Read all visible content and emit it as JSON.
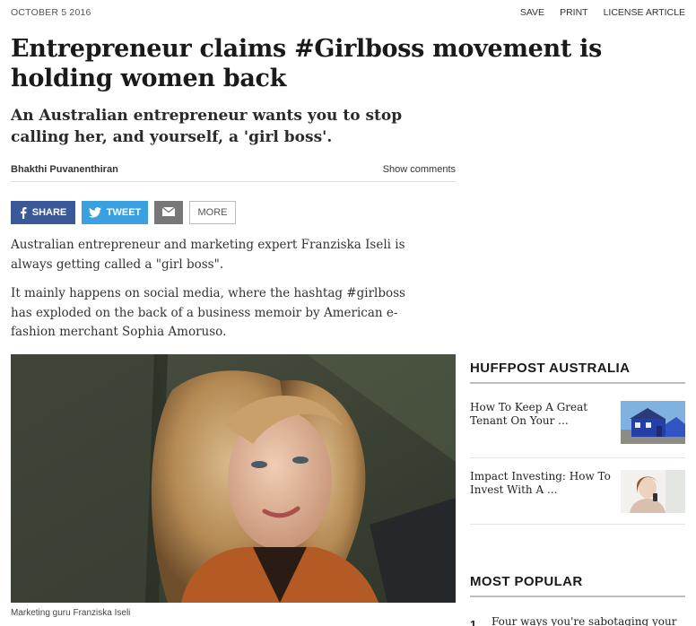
{
  "meta": {
    "date": "OCTOBER 5 2016",
    "actions": {
      "save": "SAVE",
      "print": "PRINT",
      "license": "LICENSE ARTICLE"
    }
  },
  "article": {
    "headline": "Entrepreneur claims #Girlboss movement is holding women back",
    "subhead": "An Australian entrepreneur wants you to stop calling her, and yourself, a 'girl boss'.",
    "author": "Bhakthi Puvanenthiran",
    "show_comments": "Show comments",
    "paragraphs": [
      "Australian entrepreneur and marketing expert Franziska Iseli is always getting called a \"girl boss\".",
      "It mainly happens on social media, where the hashtag #girlboss has exploded on the back of a business memoir by American e-fashion merchant Sophia Amoruso."
    ],
    "image_caption": "Marketing guru Franziska Iseli"
  },
  "share": {
    "facebook": "SHARE",
    "twitter": "TWEET",
    "more": "MORE",
    "colors": {
      "facebook": "#3b5998",
      "twitter": "#3aa0e0",
      "email": "#777777"
    }
  },
  "sidebar": {
    "title": "HUFFPOST AUSTRALIA",
    "items": [
      {
        "title": "How To Keep A Great Tenant On Your ...",
        "thumb_icon": "blue-house-photo"
      },
      {
        "title": "Impact Investing: How To Invest With A ...",
        "thumb_icon": "woman-with-phone-photo"
      }
    ]
  },
  "most_popular": {
    "title": "MOST POPULAR",
    "items": [
      {
        "rank": "1",
        "title": "Four ways you're sabotaging your"
      }
    ]
  }
}
